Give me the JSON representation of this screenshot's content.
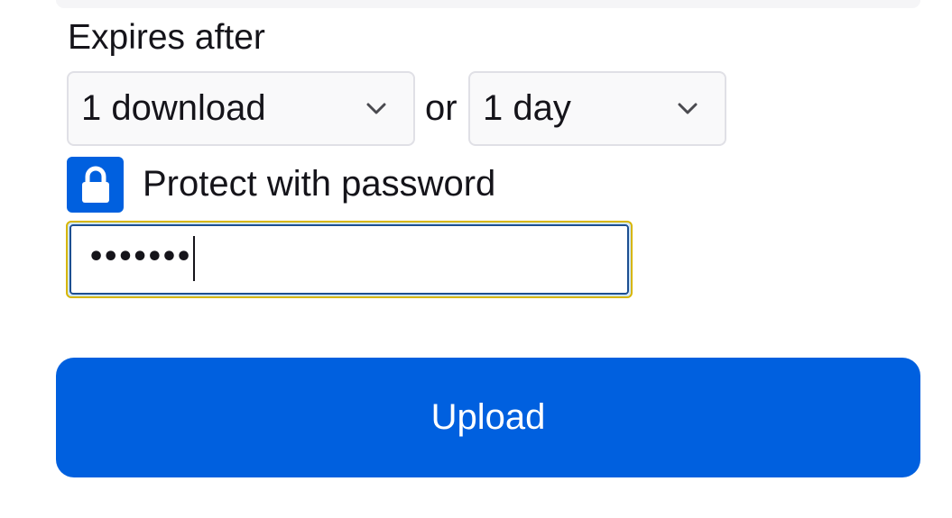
{
  "expiry": {
    "label": "Expires after",
    "downloads_select": {
      "value": "1 download"
    },
    "separator": "or",
    "days_select": {
      "value": "1 day"
    }
  },
  "password": {
    "checkbox_checked": true,
    "label": "Protect with password",
    "masked_value": "•••••••"
  },
  "upload_button": {
    "label": "Upload"
  },
  "colors": {
    "accent": "#0060df",
    "focus_ring": "#d7b600",
    "select_background": "#f9f9fa",
    "select_border": "#e0e0e6"
  },
  "icons": {
    "chevron": "chevron-down-icon",
    "lock": "lock-icon"
  }
}
